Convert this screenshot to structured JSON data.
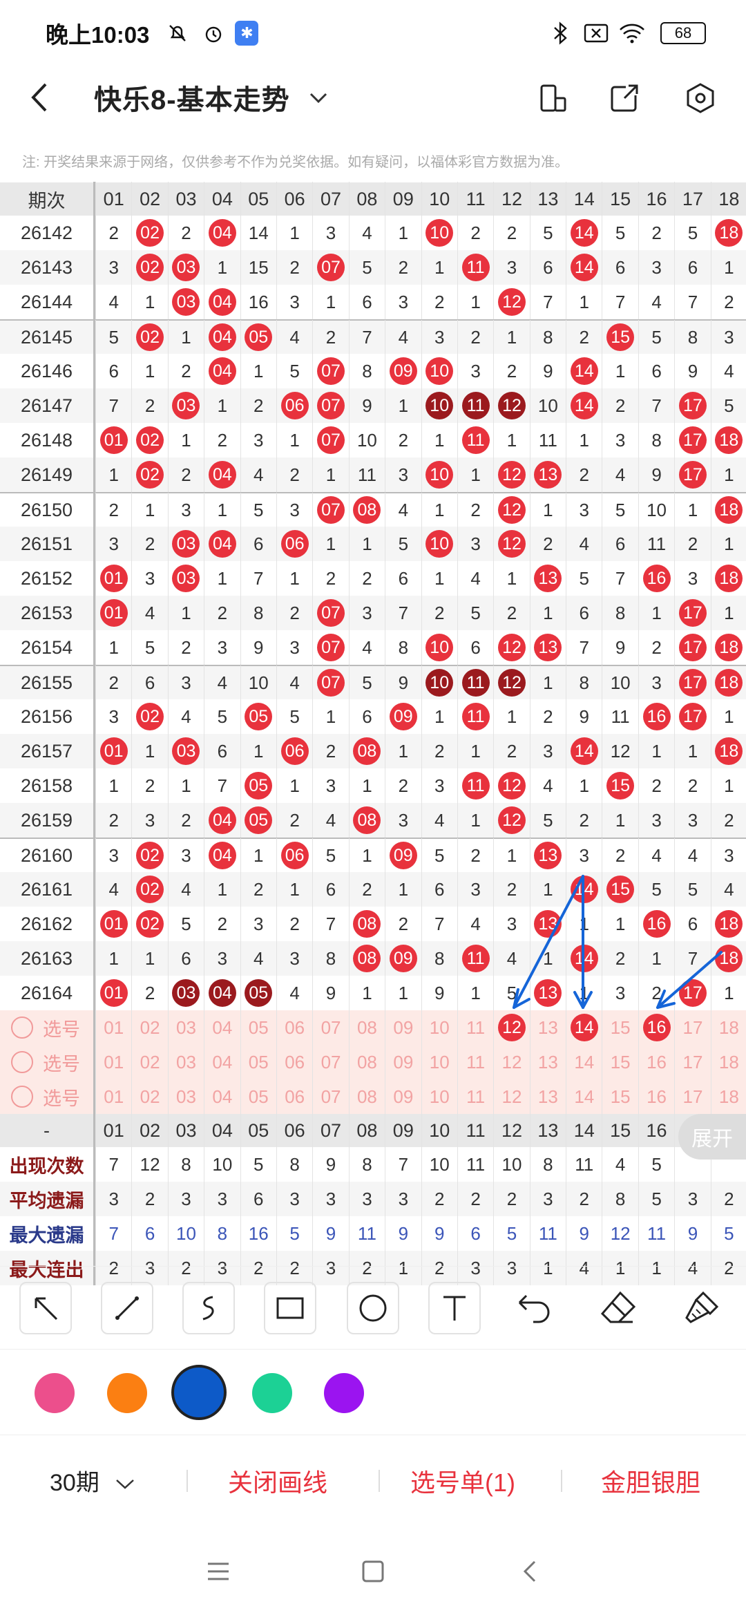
{
  "status": {
    "time": "晚上10:03",
    "battery": "68"
  },
  "header": {
    "title": "快乐8-基本走势"
  },
  "note": "注: 开奖结果来源于网络，仅供参考不作为兑奖依据。如有疑问，以福体彩官方数据为准。",
  "table": {
    "period_header": "期次",
    "columns": [
      "01",
      "02",
      "03",
      "04",
      "05",
      "06",
      "07",
      "08",
      "09",
      "10",
      "11",
      "12",
      "13",
      "14",
      "15",
      "16",
      "17",
      "18"
    ],
    "rows": [
      {
        "period": "26142",
        "cells": [
          "2",
          "02",
          "2",
          "04",
          "14",
          "1",
          "3",
          "4",
          "1",
          "10",
          "2",
          "2",
          "5",
          "14",
          "5",
          "2",
          "5",
          "18"
        ],
        "hits": [
          1,
          3,
          9,
          13,
          17
        ]
      },
      {
        "period": "26143",
        "cells": [
          "3",
          "02",
          "03",
          "1",
          "15",
          "2",
          "07",
          "5",
          "2",
          "1",
          "11",
          "3",
          "6",
          "14",
          "6",
          "3",
          "6",
          "1"
        ],
        "hits": [
          1,
          2,
          6,
          10,
          13
        ]
      },
      {
        "period": "26144",
        "cells": [
          "4",
          "1",
          "03",
          "04",
          "16",
          "3",
          "1",
          "6",
          "3",
          "2",
          "1",
          "12",
          "7",
          "1",
          "7",
          "4",
          "7",
          "2"
        ],
        "hits": [
          2,
          3,
          11
        ]
      },
      {
        "period": "26145",
        "cells": [
          "5",
          "02",
          "1",
          "04",
          "05",
          "4",
          "2",
          "7",
          "4",
          "3",
          "2",
          "1",
          "8",
          "2",
          "15",
          "5",
          "8",
          "3"
        ],
        "hits": [
          1,
          3,
          4,
          14
        ]
      },
      {
        "period": "26146",
        "cells": [
          "6",
          "1",
          "2",
          "04",
          "1",
          "5",
          "07",
          "8",
          "09",
          "10",
          "3",
          "2",
          "9",
          "14",
          "1",
          "6",
          "9",
          "4"
        ],
        "hits": [
          3,
          6,
          8,
          9,
          13
        ]
      },
      {
        "period": "26147",
        "cells": [
          "7",
          "2",
          "03",
          "1",
          "2",
          "06",
          "07",
          "9",
          "1",
          "10",
          "11",
          "12",
          "10",
          "14",
          "2",
          "7",
          "17",
          "5"
        ],
        "hits": [
          2,
          5,
          6,
          9,
          10,
          11,
          13,
          16
        ],
        "dark": [
          9,
          10,
          11
        ]
      },
      {
        "period": "26148",
        "cells": [
          "01",
          "02",
          "1",
          "2",
          "3",
          "1",
          "07",
          "10",
          "2",
          "1",
          "11",
          "1",
          "11",
          "1",
          "3",
          "8",
          "17",
          "18"
        ],
        "hits": [
          0,
          1,
          6,
          10,
          16,
          17
        ]
      },
      {
        "period": "26149",
        "cells": [
          "1",
          "02",
          "2",
          "04",
          "4",
          "2",
          "1",
          "11",
          "3",
          "10",
          "1",
          "12",
          "13",
          "2",
          "4",
          "9",
          "17",
          "1"
        ],
        "hits": [
          1,
          3,
          9,
          11,
          12,
          16
        ]
      },
      {
        "period": "26150",
        "cells": [
          "2",
          "1",
          "3",
          "1",
          "5",
          "3",
          "07",
          "08",
          "4",
          "1",
          "2",
          "12",
          "1",
          "3",
          "5",
          "10",
          "1",
          "18"
        ],
        "hits": [
          6,
          7,
          11,
          17
        ]
      },
      {
        "period": "26151",
        "cells": [
          "3",
          "2",
          "03",
          "04",
          "6",
          "06",
          "1",
          "1",
          "5",
          "10",
          "3",
          "12",
          "2",
          "4",
          "6",
          "11",
          "2",
          "1"
        ],
        "hits": [
          2,
          3,
          5,
          9,
          11
        ]
      },
      {
        "period": "26152",
        "cells": [
          "01",
          "3",
          "03",
          "1",
          "7",
          "1",
          "2",
          "2",
          "6",
          "1",
          "4",
          "1",
          "13",
          "5",
          "7",
          "16",
          "3",
          "18"
        ],
        "hits": [
          0,
          2,
          12,
          15,
          17
        ]
      },
      {
        "period": "26153",
        "cells": [
          "01",
          "4",
          "1",
          "2",
          "8",
          "2",
          "07",
          "3",
          "7",
          "2",
          "5",
          "2",
          "1",
          "6",
          "8",
          "1",
          "17",
          "1"
        ],
        "hits": [
          0,
          6,
          16
        ]
      },
      {
        "period": "26154",
        "cells": [
          "1",
          "5",
          "2",
          "3",
          "9",
          "3",
          "07",
          "4",
          "8",
          "10",
          "6",
          "12",
          "13",
          "7",
          "9",
          "2",
          "17",
          "18"
        ],
        "hits": [
          6,
          9,
          11,
          12,
          16,
          17
        ]
      },
      {
        "period": "26155",
        "cells": [
          "2",
          "6",
          "3",
          "4",
          "10",
          "4",
          "07",
          "5",
          "9",
          "10",
          "11",
          "12",
          "1",
          "8",
          "10",
          "3",
          "17",
          "18"
        ],
        "hits": [
          6,
          9,
          10,
          11,
          16,
          17
        ],
        "dark": [
          9,
          10,
          11
        ]
      },
      {
        "period": "26156",
        "cells": [
          "3",
          "02",
          "4",
          "5",
          "05",
          "5",
          "1",
          "6",
          "09",
          "1",
          "11",
          "1",
          "2",
          "9",
          "11",
          "16",
          "17",
          "1"
        ],
        "hits": [
          1,
          4,
          8,
          10,
          15,
          16
        ]
      },
      {
        "period": "26157",
        "cells": [
          "01",
          "1",
          "03",
          "6",
          "1",
          "06",
          "2",
          "08",
          "1",
          "2",
          "1",
          "2",
          "3",
          "14",
          "12",
          "1",
          "1",
          "18"
        ],
        "hits": [
          0,
          2,
          5,
          7,
          13,
          17
        ]
      },
      {
        "period": "26158",
        "cells": [
          "1",
          "2",
          "1",
          "7",
          "05",
          "1",
          "3",
          "1",
          "2",
          "3",
          "11",
          "12",
          "4",
          "1",
          "15",
          "2",
          "2",
          "1"
        ],
        "hits": [
          4,
          10,
          11,
          14
        ]
      },
      {
        "period": "26159",
        "cells": [
          "2",
          "3",
          "2",
          "04",
          "05",
          "2",
          "4",
          "08",
          "3",
          "4",
          "1",
          "12",
          "5",
          "2",
          "1",
          "3",
          "3",
          "2"
        ],
        "hits": [
          3,
          4,
          7,
          11
        ]
      },
      {
        "period": "26160",
        "cells": [
          "3",
          "02",
          "3",
          "04",
          "1",
          "06",
          "5",
          "1",
          "09",
          "5",
          "2",
          "1",
          "13",
          "3",
          "2",
          "4",
          "4",
          "3"
        ],
        "hits": [
          1,
          3,
          5,
          8,
          12
        ]
      },
      {
        "period": "26161",
        "cells": [
          "4",
          "02",
          "4",
          "1",
          "2",
          "1",
          "6",
          "2",
          "1",
          "6",
          "3",
          "2",
          "1",
          "14",
          "15",
          "5",
          "5",
          "4"
        ],
        "hits": [
          1,
          13,
          14
        ]
      },
      {
        "period": "26162",
        "cells": [
          "01",
          "02",
          "5",
          "2",
          "3",
          "2",
          "7",
          "08",
          "2",
          "7",
          "4",
          "3",
          "13",
          "1",
          "1",
          "16",
          "6",
          "18"
        ],
        "hits": [
          0,
          1,
          7,
          12,
          15,
          17
        ]
      },
      {
        "period": "26163",
        "cells": [
          "1",
          "1",
          "6",
          "3",
          "4",
          "3",
          "8",
          "08",
          "09",
          "8",
          "11",
          "4",
          "1",
          "14",
          "2",
          "1",
          "7",
          "18"
        ],
        "hits": [
          7,
          8,
          10,
          13,
          17
        ]
      },
      {
        "period": "26164",
        "cells": [
          "01",
          "2",
          "03",
          "04",
          "05",
          "4",
          "9",
          "1",
          "1",
          "9",
          "1",
          "5",
          "13",
          "1",
          "3",
          "2",
          "17",
          "1"
        ],
        "hits": [
          0,
          2,
          3,
          4,
          12,
          16
        ],
        "dark": [
          2,
          3,
          4
        ]
      }
    ],
    "select_label": "选号",
    "select_rows": [
      {
        "selected": [
          11,
          13,
          15
        ]
      },
      {
        "selected": []
      },
      {
        "selected": []
      }
    ],
    "stats_header": "-",
    "stats": [
      {
        "label": "出现次数",
        "values": [
          "7",
          "12",
          "8",
          "10",
          "5",
          "8",
          "9",
          "8",
          "7",
          "10",
          "11",
          "10",
          "8",
          "11",
          "4",
          "5",
          "",
          ""
        ],
        "blue": false
      },
      {
        "label": "平均遗漏",
        "values": [
          "3",
          "2",
          "3",
          "3",
          "6",
          "3",
          "3",
          "3",
          "3",
          "2",
          "2",
          "2",
          "3",
          "2",
          "8",
          "5",
          "3",
          "2"
        ],
        "blue": false
      },
      {
        "label": "最大遗漏",
        "values": [
          "7",
          "6",
          "10",
          "8",
          "16",
          "5",
          "9",
          "11",
          "9",
          "9",
          "6",
          "5",
          "11",
          "9",
          "12",
          "11",
          "9",
          "5"
        ],
        "blue": true
      },
      {
        "label": "最大连出",
        "values": [
          "2",
          "3",
          "2",
          "3",
          "2",
          "2",
          "3",
          "2",
          "1",
          "2",
          "3",
          "3",
          "1",
          "4",
          "1",
          "1",
          "4",
          "2"
        ],
        "blue": false
      }
    ]
  },
  "expand_label": "展开",
  "colors": [
    "#ec4f8c",
    "#fb7f12",
    "#0d5ac8",
    "#1cd195",
    "#9b14f0"
  ],
  "bottom": {
    "period": "30期",
    "close_line": "关闭画线",
    "selection": "选号单(1)",
    "golden": "金胆银胆"
  }
}
